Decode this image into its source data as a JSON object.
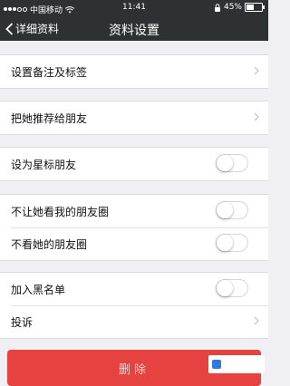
{
  "status_bar": {
    "carrier": "中国移动",
    "time": "11:41",
    "battery_percent": "45%",
    "signal_bars_filled": 3,
    "signal_bars_total": 5
  },
  "nav": {
    "back_label": "详细资料",
    "title": "资料设置"
  },
  "settings": {
    "remark": "设置备注及标签",
    "recommend": "把她推荐给朋友",
    "star": "设为星标朋友",
    "hide_my_moments": "不让她看我的朋友圈",
    "hide_her_moments": "不看她的朋友圈",
    "blacklist": "加入黑名单",
    "report": "投诉"
  },
  "toggles": {
    "star": false,
    "hide_my_moments": false,
    "hide_her_moments": false,
    "blacklist": false
  },
  "delete_button": "删除",
  "watermark": "",
  "colors": {
    "nav_bg": "#2f3034",
    "page_bg": "#efeff4",
    "danger": "#e64340"
  },
  "icons": [
    "back-chevron-icon",
    "chevron-right-icon",
    "wifi-icon",
    "lock-icon",
    "battery-icon"
  ]
}
